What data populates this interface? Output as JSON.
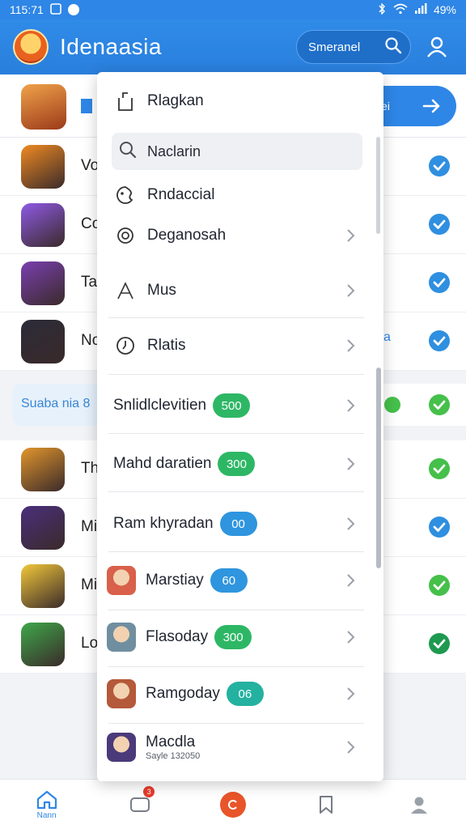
{
  "status_bar": {
    "time": "115:71",
    "battery": "49%"
  },
  "header": {
    "title": "Idenaasia",
    "search_placeholder": "Smeranel"
  },
  "background": {
    "promo_cta": "ei",
    "rows": [
      {
        "label": "Vo",
        "icon_color": "#f08a22",
        "check_color": "#2f8fe0"
      },
      {
        "label": "Co",
        "icon_color": "#8f5ae6",
        "check_color": "#2f8fe0"
      },
      {
        "label": "Ta",
        "icon_color": "#7a3fb0",
        "check_color": "#2f8fe0"
      },
      {
        "label": "No",
        "icon_color": "#2b2b38",
        "check_color": "#2f8fe0",
        "right_mark": "a"
      },
      {
        "label": "Th",
        "icon_color": "#e2962c",
        "check_color": "#45c04a"
      },
      {
        "label": "Mi",
        "icon_color": "#4a2f7c",
        "check_color": "#2f8fe0"
      },
      {
        "label": "Mi",
        "icon_color": "#f2c83a",
        "check_color": "#45c04a"
      },
      {
        "label": "Lo",
        "icon_color": "#3fa84a",
        "check_color": "#1e9a50"
      }
    ],
    "section_label": "Suaba nia 8",
    "section_check_color": "#45c04a"
  },
  "menu": {
    "items": {
      "first": "Rlagkan",
      "search": "Naclarin",
      "rndacial": "Rndaccial",
      "deganosah": "Deganosah",
      "mus": "Mus",
      "rlatis": "Rlatis"
    },
    "counted": [
      {
        "label": "Snlidlclevitien",
        "count": "500",
        "color": "green"
      },
      {
        "label": "Mahd daratien",
        "count": "300",
        "color": "green"
      },
      {
        "label": "Ram khyradan",
        "count": "00",
        "color": "blue"
      }
    ],
    "people": [
      {
        "label": "Marstiay",
        "count": "60",
        "color": "blue",
        "avatar": "#d9604a"
      },
      {
        "label": "Flasoday",
        "count": "300",
        "color": "green",
        "avatar": "#6f8fa0"
      },
      {
        "label": "Ramgoday",
        "count": "06",
        "color": "teal",
        "avatar": "#b4593a"
      },
      {
        "label": "Macdla",
        "sub": "Sayle 132050",
        "avatar": "#4a3a7a"
      }
    ]
  },
  "bottom_nav": {
    "home_label": "Nann",
    "badge_count": "3"
  }
}
